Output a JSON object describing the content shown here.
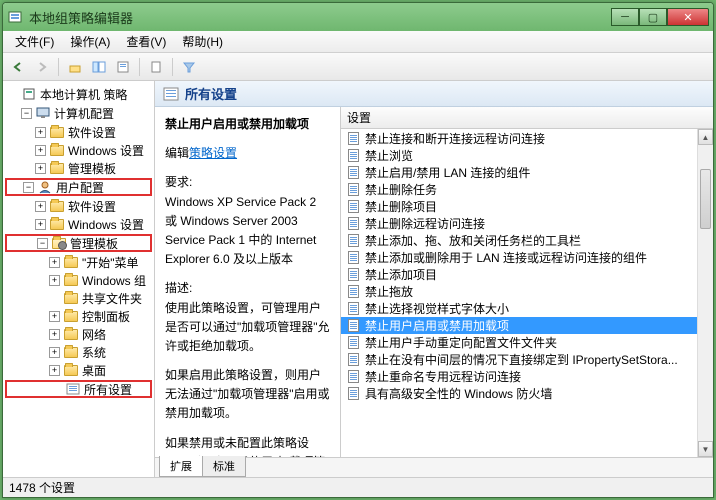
{
  "window": {
    "title": "本地组策略编辑器"
  },
  "menu": {
    "file": "文件(F)",
    "action": "操作(A)",
    "view": "查看(V)",
    "help": "帮助(H)"
  },
  "tree": {
    "root": "本地计算机 策略",
    "computer_cfg": "计算机配置",
    "software": "软件设置",
    "windows_settings": "Windows 设置",
    "admin_templates": "管理模板",
    "user_cfg": "用户配置",
    "start_menus": "\"开始\"菜单",
    "windows_group": "Windows 组",
    "shared_folders": "共享文件夹",
    "control_panel": "控制面板",
    "network": "网络",
    "system": "系统",
    "desktop": "桌面",
    "all_settings": "所有设置"
  },
  "header": {
    "title": "所有设置"
  },
  "detail": {
    "title": "禁止用户启用或禁用加载项",
    "edit_prefix": "编辑",
    "edit_link": "策略设置",
    "req_label": "要求:",
    "req_text": "Windows XP Service Pack 2 或 Windows Server 2003 Service Pack 1 中的 Internet Explorer 6.0 及以上版本",
    "desc_label": "描述:",
    "desc_p1": "使用此策略设置，可管理用户是否可以通过\"加载项管理器\"允许或拒绝加载项。",
    "desc_p2": "如果启用此策略设置，则用户无法通过\"加载项管理器\"启用或禁用加载项。",
    "desc_p3": "如果禁用或未配置此策略设置，则用户可以使用\"加载项管理器\"中"
  },
  "list": {
    "column": "设置",
    "items": [
      "禁止连接和断开连接远程访问连接",
      "禁止浏览",
      "禁止启用/禁用 LAN 连接的组件",
      "禁止删除任务",
      "禁止删除项目",
      "禁止删除远程访问连接",
      "禁止添加、拖、放和关闭任务栏的工具栏",
      "禁止添加或删除用于 LAN 连接或远程访问连接的组件",
      "禁止添加项目",
      "禁止拖放",
      "禁止选择视觉样式字体大小",
      "禁止用户启用或禁用加载项",
      "禁止用户手动重定向配置文件文件夹",
      "禁止在没有中间层的情况下直接绑定到 IPropertySetStora...",
      "禁止重命名专用远程访问连接",
      "具有高级安全性的 Windows 防火墙"
    ],
    "selected_index": 11
  },
  "tabs": {
    "extended": "扩展",
    "standard": "标准"
  },
  "status": {
    "text": "1478 个设置"
  }
}
